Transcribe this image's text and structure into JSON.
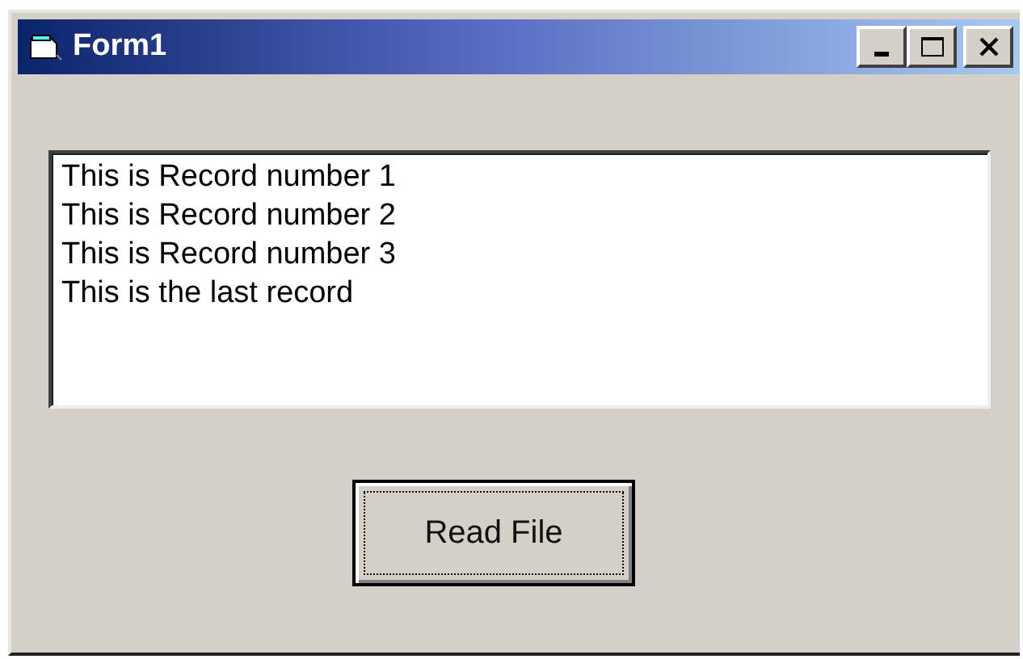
{
  "window": {
    "title": "Form1"
  },
  "text_box": {
    "lines": [
      "This is Record number 1",
      "This is Record number 2",
      "This is Record number 3",
      "This is the last record"
    ]
  },
  "buttons": [
    {
      "label": "Read File",
      "focused": true
    }
  ]
}
